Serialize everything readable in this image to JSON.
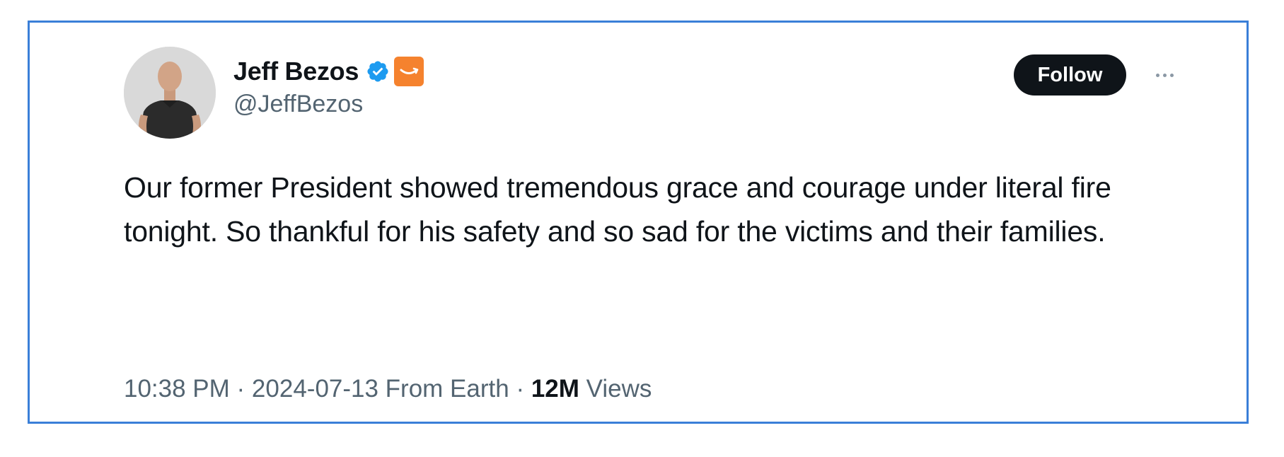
{
  "author": {
    "display_name": "Jeff Bezos",
    "handle": "@JeffBezos",
    "verified_icon": "verified-badge-icon",
    "affiliate_icon": "amazon-logo-icon",
    "verified_color": "#1d9bf0",
    "affiliate_color": "#f5822e"
  },
  "actions": {
    "follow_label": "Follow",
    "more_icon": "more-options-icon"
  },
  "tweet": {
    "text": "Our former President showed tremendous grace and courage under literal fire tonight. So thankful for his safety and so sad for the victims and their families.",
    "time": "10:38 PM",
    "separator_1": " · ",
    "date_location": "2024-07-13 From Earth",
    "separator_2": " · ",
    "views_count": "12M",
    "views_label": " Views"
  },
  "colors": {
    "border": "#3a7fd8",
    "follow_bg": "#0f1419",
    "secondary_text": "#536471"
  }
}
